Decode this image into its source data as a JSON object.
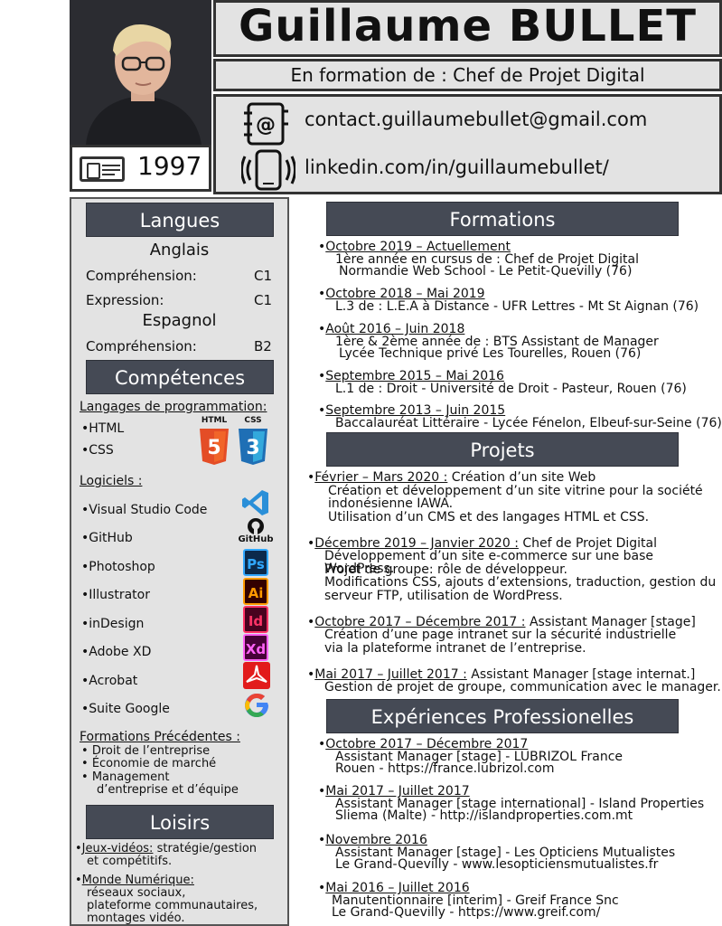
{
  "header": {
    "name": "Guillaume BULLET",
    "subtitle": "En formation de : Chef de Projet Digital",
    "birth_year": "1997",
    "email": "contact.guillaumebullet@gmail.com",
    "linkedin": "linkedin.com/in/guillaumebullet/"
  },
  "langues": {
    "title": "Langues",
    "lang1": "Anglais",
    "lang1_rows": [
      {
        "label": "Compréhension:",
        "level": "C1"
      },
      {
        "label": "Expression:",
        "level": "C1"
      }
    ],
    "lang2": "Espagnol",
    "lang2_rows": [
      {
        "label": "Compréhension:",
        "level": "B2"
      }
    ]
  },
  "competences": {
    "title": "Compétences",
    "prog_title": "Langages de programmation:",
    "prog": [
      "HTML",
      "CSS"
    ],
    "html_badge_caption": "HTML",
    "css_badge_caption": "CSS",
    "logiciels_title": "Logiciels :",
    "logiciels": [
      "Visual Studio Code",
      "GitHub",
      "Photoshop",
      "Illustrator",
      "inDesign",
      "Adobe XD",
      "Acrobat",
      "Suite Google"
    ],
    "github_caption": "GitHub",
    "ps_badge": "Ps",
    "ai_badge": "Ai",
    "id_badge": "Id",
    "xd_badge": "Xd",
    "google_badge": "G",
    "formations_prec_title": "Formations Précédentes :",
    "formations_prec": [
      "Droit de l’entreprise",
      "Économie de marché",
      "Management",
      "d’entreprise et d’équipe"
    ]
  },
  "loisirs": {
    "title": "Loisirs",
    "items": [
      {
        "label": "Jeux-vidéos:",
        "line1": " stratégie/gestion",
        "line2": "et compétitifs."
      },
      {
        "label": "Monde Numérique:",
        "line1": "réseaux sociaux,",
        "line2": "plateforme communautaires,",
        "line3": "montages vidéo."
      }
    ]
  },
  "formations": {
    "title": "Formations",
    "items": [
      {
        "date": "Octobre 2019 – Actuellement",
        "l1": "1ère année en cursus de : Chef de Projet Digital",
        "l2": "Normandie Web School - Le Petit-Quevilly (76)"
      },
      {
        "date": "Octobre 2018 – Mai 2019",
        "l1": "L.3 de : L.E.A à Distance - UFR Lettres - Mt St Aignan (76)",
        "l2": ""
      },
      {
        "date": "Août 2016 – Juin 2018",
        "l1": "1ère & 2ème année de : BTS Assistant de Manager",
        "l2": "Lycée Technique privé Les Tourelles, Rouen (76)"
      },
      {
        "date": "Septembre 2015 – Mai 2016",
        "l1": "L.1 de : Droit - Université de Droit - Pasteur, Rouen (76)",
        "l2": ""
      },
      {
        "date": "Septembre 2013 – Juin 2015",
        "l1": "Baccalauréat Littéraire - Lycée Fénelon, Elbeuf-sur-Seine (76)",
        "l2": ""
      }
    ]
  },
  "projets": {
    "title": "Projets",
    "items": [
      {
        "date": "Février – Mars 2020 :",
        "role": " Création d’un site Web",
        "lines": [
          "Création et développement d’un site vitrine pour la société",
          "indonésienne IAWA.",
          "Utilisation d’un CMS et des langages HTML et CSS."
        ]
      },
      {
        "date": "Décembre 2019 – Janvier 2020 :",
        "role": " Chef de Projet Digital",
        "lines": [
          "Développement d’un site e-commerce sur une base WordPress.",
          "Projet de groupe: rôle de développeur.",
          "Modifications CSS, ajouts d’extensions, traduction, gestion du",
          "serveur FTP, utilisation de WordPress."
        ]
      },
      {
        "date": "Octobre 2017 – Décembre 2017 :",
        "role": " Assistant Manager [stage]",
        "lines": [
          "Création d’une page intranet sur la sécurité industrielle",
          "via la plateforme intranet de l’entreprise."
        ]
      },
      {
        "date": "Mai 2017 – Juillet 2017 :",
        "role": " Assistant Manager [stage internat.]",
        "lines": [
          "Gestion de projet de groupe, communication avec le manager."
        ]
      }
    ]
  },
  "experiences": {
    "title": "Expériences Professionelles",
    "items": [
      {
        "date": "Octobre 2017 – Décembre 2017",
        "l1": "Assistant Manager [stage] -  LUBRIZOL France",
        "l2": "Rouen - https://france.lubrizol.com"
      },
      {
        "date": "Mai 2017 – Juillet 2017",
        "l1": "Assistant Manager [stage international] - Island Properties",
        "l2": "Sliema (Malte) - http://islandproperties.com.mt"
      },
      {
        "date": "Novembre 2016",
        "l1": "Assistant Manager [stage] - Les Opticiens Mutualistes",
        "l2": "Le Grand-Quevilly - www.lesopticiensmutualistes.fr"
      },
      {
        "date": "Mai 2016 – Juillet 2016",
        "l1": "Manutentionnaire [interim] - Greif France Snc",
        "l2": "Le Grand-Quevilly - https://www.greif.com/"
      }
    ]
  },
  "colors": {
    "header_bar": "#454a55",
    "panel": "#e3e3e3",
    "html5": "#e44d26",
    "css3": "#1f6fb5"
  }
}
